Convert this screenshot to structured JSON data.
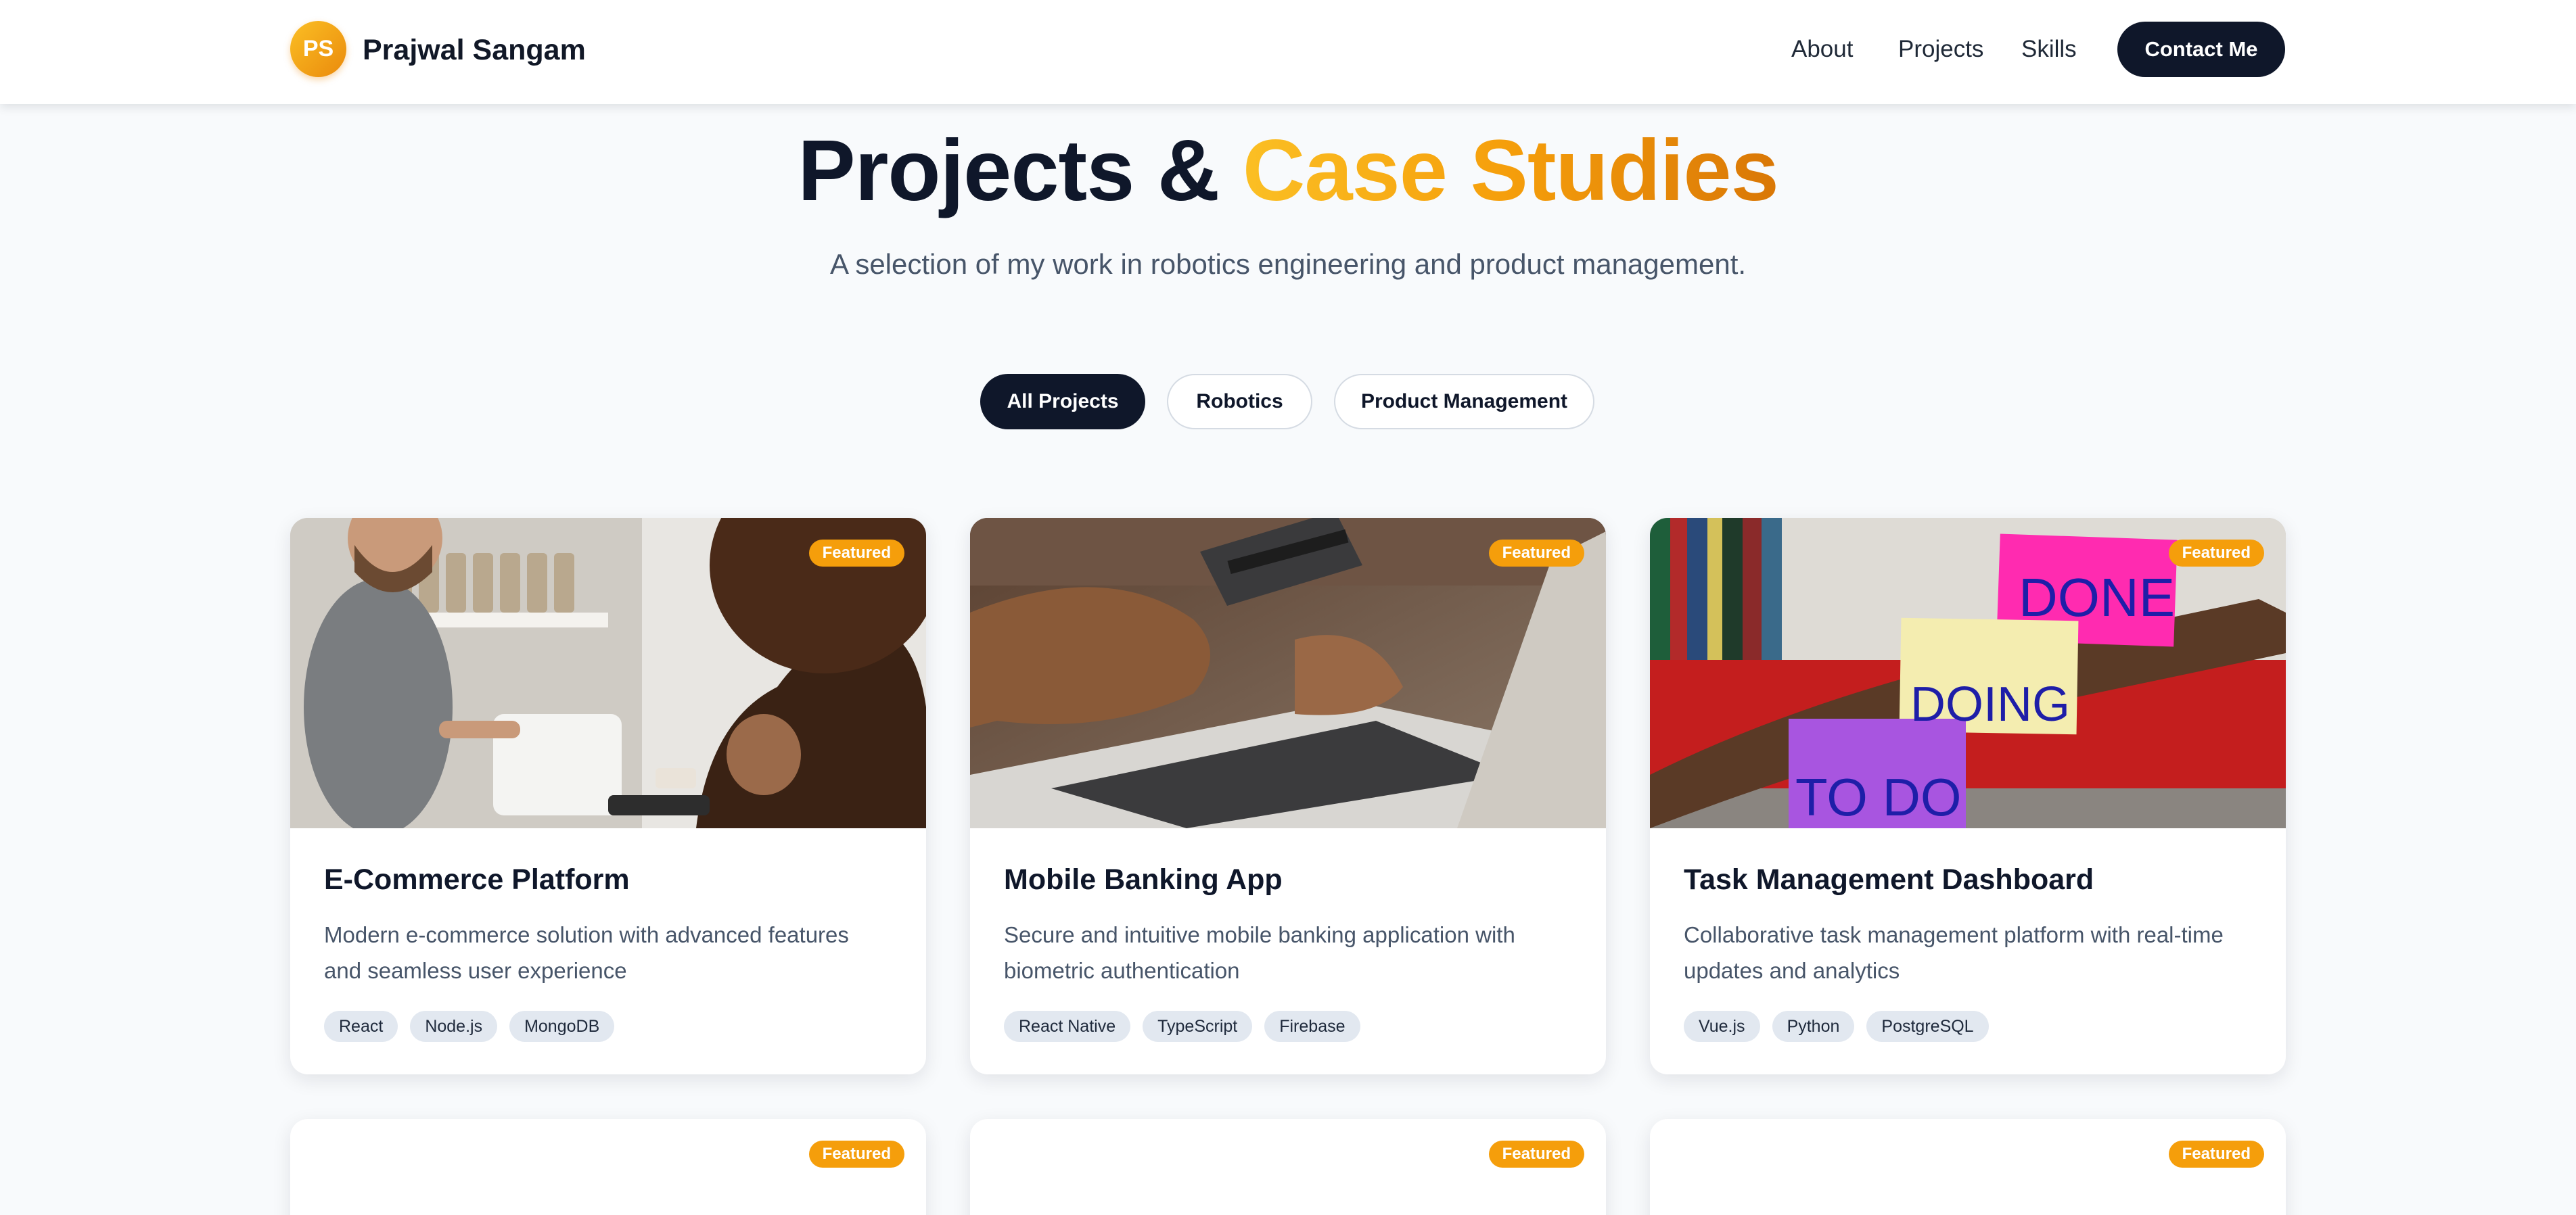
{
  "header": {
    "logo_initials": "PS",
    "brand_name": "Prajwal Sangam",
    "nav": {
      "about": "About",
      "projects": "Projects",
      "skills": "Skills"
    },
    "contact_label": "Contact Me"
  },
  "hero": {
    "title_part1": "Projects &",
    "title_part2": "Case Studies",
    "subtitle": "A selection of my work in robotics engineering and product management."
  },
  "filters": [
    "All Projects",
    "Robotics",
    "Product Management"
  ],
  "projects": [
    {
      "title": "E-Commerce Platform",
      "description": "Modern e-commerce solution with advanced features and seamless user experience",
      "tags": [
        "React",
        "Node.js",
        "MongoDB"
      ],
      "badge": "Featured"
    },
    {
      "title": "Mobile Banking App",
      "description": "Secure and intuitive mobile banking application with biometric authentication",
      "tags": [
        "React Native",
        "TypeScript",
        "Firebase"
      ],
      "badge": "Featured"
    },
    {
      "title": "Task Management Dashboard",
      "description": "Collaborative task management platform with real-time updates and analytics",
      "tags": [
        "Vue.js",
        "Python",
        "PostgreSQL"
      ],
      "badge": "Featured"
    }
  ],
  "more_projects": [
    {
      "badge": "Featured"
    },
    {
      "badge": "Featured"
    },
    {
      "badge": "Featured"
    }
  ],
  "sticky_notes": [
    "DONE",
    "DOING",
    "TO DO"
  ],
  "colors": {
    "primary_dark": "#0f172a",
    "accent": "#f59e0b",
    "background": "#f8fafc",
    "tag_bg": "#e2e8f0"
  }
}
